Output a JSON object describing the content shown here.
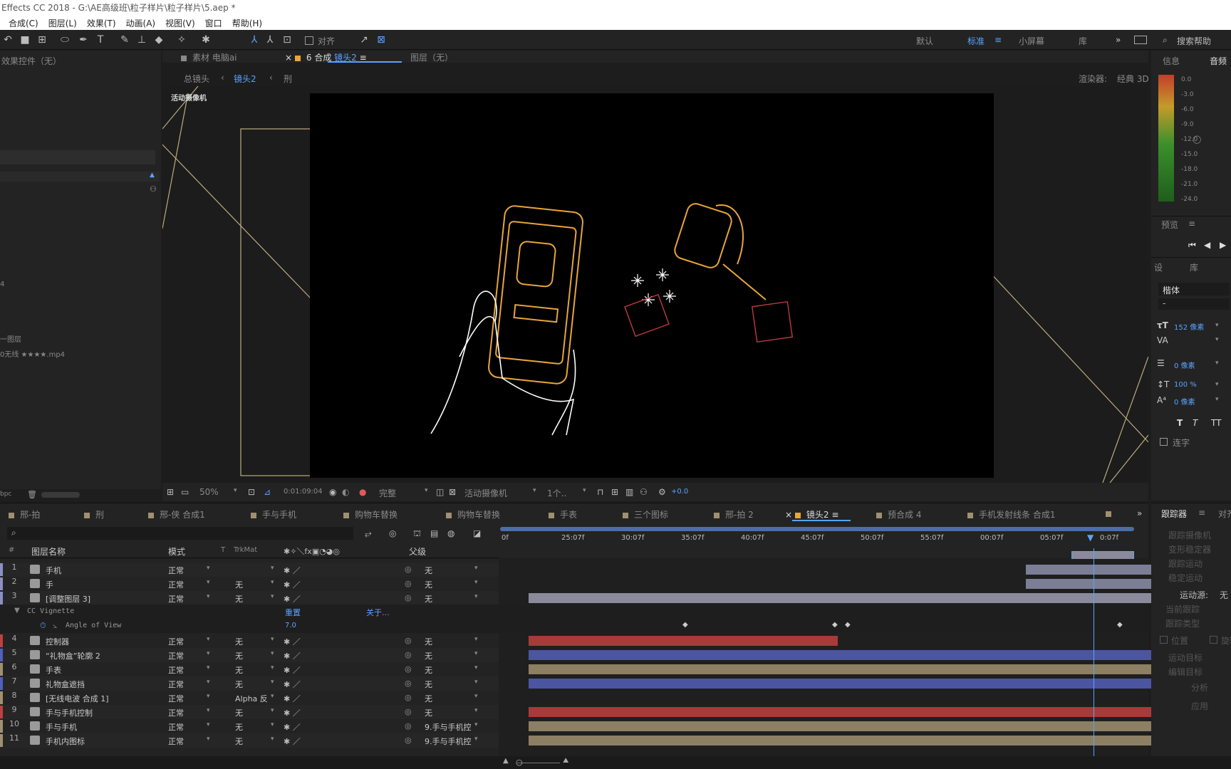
{
  "titlebar": {
    "title": "Effects CC 2018 - G:\\AE高级班\\粒子样片\\粒子样片\\5.aep *"
  },
  "menu": [
    "合成(C)",
    "图层(L)",
    "效果(T)",
    "动画(A)",
    "视图(V)",
    "窗口",
    "帮助(H)"
  ],
  "toolbar": {
    "snap_label": "对齐"
  },
  "workspaces": [
    "默认",
    "标准",
    "小屏幕",
    "库"
  ],
  "search_help": "搜索帮助",
  "effects_panel": {
    "title": "效果控件（无）",
    "items": [
      "4",
      "一图层",
      "0无线 ★★★★.mp4"
    ],
    "bpc": "bpc"
  },
  "viewer_tabs": {
    "footage": "素材 电脑ai",
    "comp_prefix": "合成",
    "comp_name": "镜头2",
    "layer": "图层（无）"
  },
  "breadcrumb": {
    "root": "总镜头",
    "current": "镜头2",
    "next": "刑"
  },
  "renderer": {
    "label": "渲染器:",
    "value": "经典 3D"
  },
  "viewer_label": "活动摄像机",
  "viewer_footer": {
    "zoom": "50%",
    "timecode": "0:01:09:04",
    "quality": "完整",
    "camera": "活动摄像机",
    "views": "1个..",
    "exposure": "+0.0"
  },
  "right_panel": {
    "tabs": [
      "信息",
      "音频"
    ],
    "meter_ticks": [
      "0.0",
      "-3.0",
      "-6.0",
      "-9.0",
      "-12.0",
      "-15.0",
      "-18.0",
      "-21.0",
      "-24.0"
    ],
    "preview": "预览",
    "char_tabs": [
      "设",
      "库"
    ],
    "font": "楷体",
    "font_style": "-",
    "font_size": "152 像素",
    "tracking_label": "VA",
    "stroke": "0 像素",
    "vscale": "100 %",
    "baseline": "0 像素",
    "styles": [
      "T",
      "T",
      "TT"
    ],
    "ligature": "连字",
    "tracker": "跟踪器",
    "tracker_tab2": "对齐",
    "tracker_items": [
      "跟踪摄像机",
      "变形稳定器",
      "跟踪运动",
      "稳定运动"
    ],
    "motion_source_label": "运动源:",
    "motion_source_value": "无",
    "tracker_items2": [
      "当前跟踪",
      "跟踪类型"
    ],
    "pos_checks": [
      "位置",
      "旋转"
    ],
    "tracker_items3": [
      "运动目标",
      "编辑目标"
    ],
    "analyze": "分析",
    "apply": "应用"
  },
  "comp_tabs": [
    "邢-拍",
    "刑",
    "邢-侠 合成1",
    "手与手机",
    "购物车替换",
    "购物车替换",
    "手表",
    "三个图标",
    "邢-拍 2",
    "镜头2",
    "预合成 4",
    "手机发射线条 合成1"
  ],
  "timeline": {
    "search_placeholder": "",
    "col_headers": {
      "num": "#",
      "name": "图层名称",
      "mode": "模式",
      "t": "T",
      "trkmat": "TrkMat",
      "parent": "父级"
    },
    "ruler": [
      "0f",
      "25:07f",
      "30:07f",
      "35:07f",
      "40:07f",
      "45:07f",
      "50:07f",
      "55:07f",
      "00:07f",
      "05:07f",
      "0:07f"
    ],
    "effect_row": {
      "name": "CC Vignette",
      "reset": "重置",
      "about": "关于..."
    },
    "prop_row": {
      "name": "Angle of View",
      "value": "7.0"
    },
    "layers": [
      {
        "num": "1",
        "name": "手机",
        "mode": "正常",
        "trk": "",
        "parent": "无",
        "color": "#8c8fc4",
        "bar": [
          1440,
          1652
        ],
        "bar_color": "#7c7e95"
      },
      {
        "num": "2",
        "name": "手",
        "mode": "正常",
        "trk": "无",
        "parent": "无",
        "color": "#8c8fc4",
        "bar": [
          1440,
          1652
        ],
        "bar_color": "#7c7e95"
      },
      {
        "num": "3",
        "name": "[调整图层 3]",
        "mode": "正常",
        "trk": "无",
        "parent": "无",
        "color": "#8c8fc4",
        "bar": [
          742,
          1664
        ],
        "bar_color": "#8a8a9c"
      },
      {
        "num": "4",
        "name": "控制器",
        "mode": "正常",
        "trk": "无",
        "parent": "无",
        "color": "#c04040",
        "bar": [
          742,
          1176
        ],
        "bar_color": "#a83a3a"
      },
      {
        "num": "5",
        "name": "“礼物盒”轮廓 2",
        "mode": "正常",
        "trk": "无",
        "parent": "无",
        "color": "#5060c0",
        "bar": [
          742,
          1664
        ],
        "bar_color": "#4b55a2"
      },
      {
        "num": "6",
        "name": "手表",
        "mode": "正常",
        "trk": "无",
        "parent": "无",
        "color": "#a09070",
        "bar": [
          742,
          1664
        ],
        "bar_color": "#8d7f63"
      },
      {
        "num": "7",
        "name": "礼物盒遮挡",
        "mode": "正常",
        "trk": "无",
        "parent": "无",
        "color": "#5060c0",
        "bar": [
          742,
          1664
        ],
        "bar_color": "#4b55a2"
      },
      {
        "num": "8",
        "name": "[无线电波 合成 1]",
        "mode": "正常",
        "trk": "Alpha 反",
        "parent": "无",
        "color": "#a09070",
        "bar": [
          1620,
          1664
        ],
        "bar_color": "#8d7f63"
      },
      {
        "num": "9",
        "name": "手与手机控制",
        "mode": "正常",
        "trk": "无",
        "parent": "无",
        "color": "#c04040",
        "bar": [
          742,
          1664
        ],
        "bar_color": "#a83a3a"
      },
      {
        "num": "10",
        "name": "手与手机",
        "mode": "正常",
        "trk": "无",
        "parent": "9.手与手机控",
        "color": "#a09070",
        "bar": [
          742,
          1664
        ],
        "bar_color": "#8d7f63"
      },
      {
        "num": "11",
        "name": "手机内图标",
        "mode": "正常",
        "trk": "无",
        "parent": "9.手与手机控",
        "color": "#a09070",
        "bar": [
          742,
          1664
        ],
        "bar_color": "#8d7f63"
      }
    ]
  }
}
